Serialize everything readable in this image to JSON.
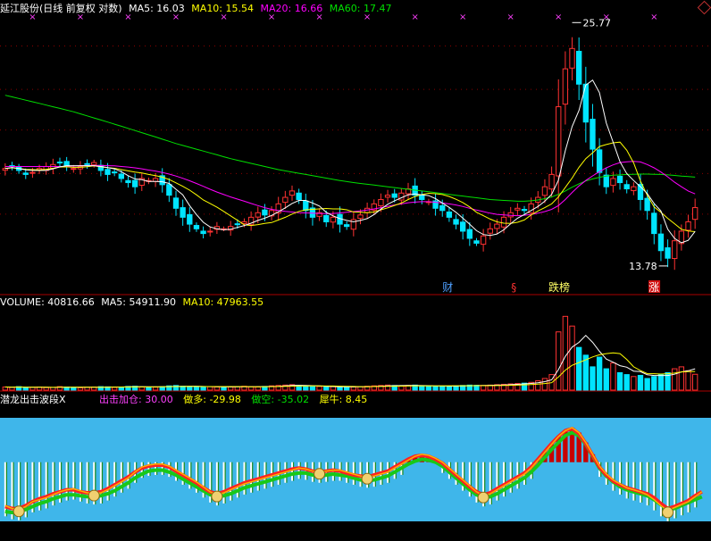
{
  "header": {
    "stock": "延江股份(日线 前复权 对数)",
    "ma5": "MA5: 16.03",
    "ma10": "MA10: 15.54",
    "ma20": "MA20: 16.66",
    "ma60": "MA60: 17.47"
  },
  "volume_header": {
    "label": "VOLUME: 40816.66",
    "ma5": "MA5: 54911.90",
    "ma10": "MA10: 47963.55"
  },
  "indicator_header": {
    "name": "潜龙出击波段X",
    "attack": "出击加仓: 30.00",
    "long": "做多: -29.98",
    "short": "做空: -35.02",
    "bull": "犀牛: 8.45"
  },
  "colors": {
    "up": "#ff3232",
    "down": "#00e4ff",
    "ma5": "#ffffff",
    "ma10": "#ffff00",
    "ma20": "#ff00ff",
    "ma60": "#00e000",
    "grid": "#8b0000",
    "indicator_bg": "#3fb6ea"
  },
  "chart_data": [
    {
      "type": "candlestick",
      "panel": "price",
      "scale": "log",
      "ylim": [
        12.8,
        27.5
      ],
      "max_label": "25.77",
      "min_label": "13.78",
      "events": [
        {
          "label": "财",
          "x": 0.64
        },
        {
          "label": "§",
          "x": 0.735
        },
        {
          "label": "跌榜",
          "x": 0.8
        },
        {
          "label": "涨",
          "x": 0.936
        }
      ],
      "closes": [
        17.9,
        18.0,
        17.8,
        17.6,
        17.7,
        17.9,
        18.0,
        18.1,
        18.2,
        18.0,
        17.9,
        18.0,
        18.1,
        18.2,
        17.8,
        17.6,
        17.7,
        17.4,
        17.2,
        17.0,
        17.4,
        17.3,
        17.4,
        17.1,
        16.6,
        16.0,
        15.6,
        15.3,
        15.1,
        14.9,
        15.0,
        15.2,
        15.1,
        15.2,
        15.3,
        15.4,
        15.6,
        15.8,
        15.7,
        15.9,
        16.2,
        16.5,
        16.8,
        16.4,
        15.9,
        15.6,
        15.8,
        15.4,
        15.6,
        15.3,
        15.2,
        15.5,
        15.7,
        16.0,
        16.2,
        16.4,
        16.6,
        16.5,
        16.7,
        16.9,
        16.6,
        16.4,
        16.3,
        16.0,
        15.9,
        15.6,
        15.3,
        15.0,
        14.7,
        14.5,
        14.8,
        15.1,
        15.3,
        15.6,
        15.8,
        16.0,
        15.9,
        16.2,
        16.5,
        17.0,
        17.6,
        21.3,
        23.7,
        25.1,
        22.7,
        20.4,
        18.9,
        17.7,
        17.0,
        17.4,
        17.2,
        16.9,
        17.0,
        16.4,
        15.9,
        14.9,
        14.2,
        13.9,
        14.6,
        15.0,
        15.4,
        16.03
      ],
      "ma5": [
        17.9,
        17.95,
        17.9,
        17.83,
        17.8,
        17.8,
        17.8,
        17.88,
        17.98,
        18.04,
        18.04,
        18.04,
        18.04,
        18.04,
        18.0,
        17.94,
        17.88,
        17.74,
        17.54,
        17.38,
        17.34,
        17.26,
        17.26,
        17.24,
        17.16,
        16.88,
        16.62,
        16.12,
        15.72,
        15.38,
        15.18,
        15.1,
        15.06,
        15.08,
        15.16,
        15.24,
        15.34,
        15.46,
        15.56,
        15.68,
        15.84,
        16.02,
        16.22,
        16.36,
        16.36,
        16.24,
        16.1,
        15.82,
        15.66,
        15.54,
        15.46,
        15.4,
        15.46,
        15.54,
        15.72,
        15.96,
        16.18,
        16.34,
        16.48,
        16.62,
        16.66,
        16.62,
        16.58,
        16.44,
        16.24,
        16.04,
        15.82,
        15.56,
        15.3,
        15.02,
        14.86,
        14.82,
        14.88,
        15.06,
        15.32,
        15.56,
        15.72,
        15.9,
        16.08,
        16.32,
        16.64,
        17.32,
        18.82,
        20.14,
        21.08,
        22.64,
        22.96,
        22.16,
        20.34,
        19.28,
        18.24,
        17.64,
        17.3,
        17.0,
        16.68,
        16.22,
        15.88,
        15.08,
        14.7,
        14.52,
        14.62,
        14.99
      ],
      "ma10": [
        17.9,
        17.93,
        17.9,
        17.85,
        17.84,
        17.83,
        17.86,
        17.91,
        17.97,
        17.98,
        17.96,
        17.96,
        17.99,
        18.03,
        17.98,
        17.94,
        17.91,
        17.84,
        17.78,
        17.72,
        17.67,
        17.6,
        17.54,
        17.47,
        17.35,
        17.19,
        17.02,
        16.84,
        16.62,
        16.38,
        16.22,
        16.05,
        15.86,
        15.66,
        15.47,
        15.27,
        15.24,
        15.28,
        15.33,
        15.37,
        15.48,
        15.6,
        15.74,
        15.86,
        15.93,
        15.95,
        15.97,
        15.99,
        15.97,
        15.97,
        15.93,
        15.83,
        15.82,
        15.8,
        15.83,
        15.93,
        16.02,
        16.13,
        16.24,
        16.4,
        16.54,
        16.63,
        16.69,
        16.67,
        16.63,
        16.54,
        16.41,
        16.26,
        16.06,
        15.82,
        15.67,
        15.52,
        15.4,
        15.34,
        15.33,
        15.38,
        15.48,
        15.7,
        15.88,
        16.03,
        16.2,
        16.52,
        16.97,
        17.42,
        17.96,
        18.4,
        18.71,
        19.04,
        19.15,
        19.24,
        19.28,
        18.84,
        18.18,
        17.28,
        16.6,
        16.06,
        15.82,
        15.55,
        15.32,
        15.08,
        15.01,
        14.98
      ],
      "ma20": [
        18.0,
        18.0,
        18.0,
        18.0,
        18.0,
        18.0,
        18.0,
        18.0,
        18.0,
        18.0,
        18.02,
        18.04,
        18.05,
        18.05,
        18.05,
        18.04,
        18.03,
        18.0,
        17.97,
        17.93,
        17.88,
        17.82,
        17.77,
        17.7,
        17.62,
        17.52,
        17.41,
        17.29,
        17.16,
        17.02,
        16.88,
        16.75,
        16.63,
        16.52,
        16.42,
        16.32,
        16.22,
        16.12,
        16.03,
        15.95,
        15.9,
        15.86,
        15.83,
        15.8,
        15.79,
        15.78,
        15.77,
        15.76,
        15.77,
        15.79,
        15.82,
        15.85,
        15.88,
        15.92,
        15.97,
        16.03,
        16.09,
        16.15,
        16.2,
        16.25,
        16.28,
        16.3,
        16.3,
        16.27,
        16.24,
        16.2,
        16.15,
        16.08,
        16.0,
        15.92,
        15.85,
        15.78,
        15.73,
        15.7,
        15.68,
        15.67,
        15.69,
        15.72,
        15.78,
        15.85,
        15.95,
        16.12,
        16.4,
        16.73,
        17.04,
        17.3,
        17.53,
        17.74,
        17.93,
        18.08,
        18.2,
        18.24,
        18.26,
        18.23,
        18.1,
        17.93,
        17.72,
        17.48,
        17.22,
        17.0,
        16.8,
        16.66
      ],
      "ma60": [
        22.0,
        21.9,
        21.8,
        21.7,
        21.6,
        21.5,
        21.4,
        21.3,
        21.2,
        21.1,
        21.0,
        20.88,
        20.76,
        20.64,
        20.52,
        20.4,
        20.28,
        20.16,
        20.04,
        19.92,
        19.8,
        19.68,
        19.56,
        19.44,
        19.32,
        19.2,
        19.1,
        19.0,
        18.9,
        18.8,
        18.7,
        18.6,
        18.5,
        18.4,
        18.32,
        18.24,
        18.16,
        18.08,
        18.0,
        17.92,
        17.84,
        17.78,
        17.72,
        17.66,
        17.6,
        17.54,
        17.48,
        17.42,
        17.36,
        17.3,
        17.25,
        17.2,
        17.16,
        17.12,
        17.08,
        17.04,
        17.0,
        16.96,
        16.92,
        16.88,
        16.84,
        16.8,
        16.76,
        16.72,
        16.68,
        16.64,
        16.6,
        16.56,
        16.52,
        16.48,
        16.44,
        16.4,
        16.38,
        16.36,
        16.34,
        16.32,
        16.32,
        16.34,
        16.38,
        16.44,
        16.52,
        16.64,
        16.8,
        16.98,
        17.14,
        17.28,
        17.38,
        17.46,
        17.52,
        17.56,
        17.58,
        17.6,
        17.61,
        17.62,
        17.62,
        17.61,
        17.6,
        17.58,
        17.55,
        17.52,
        17.5,
        17.47
      ]
    },
    {
      "type": "bar",
      "panel": "volume",
      "ylim": [
        0,
        200000
      ],
      "values": [
        8000,
        7000,
        9000,
        6000,
        7000,
        8000,
        6500,
        7000,
        9000,
        8000,
        7000,
        6000,
        7500,
        8000,
        9000,
        8500,
        7000,
        8000,
        9500,
        10000,
        8000,
        7000,
        7500,
        9000,
        11000,
        12000,
        10000,
        9000,
        8000,
        8500,
        9000,
        8000,
        7500,
        8000,
        9000,
        10000,
        9000,
        8000,
        9500,
        11000,
        12000,
        13000,
        14000,
        12000,
        10000,
        9000,
        9500,
        8500,
        9000,
        8000,
        7500,
        8000,
        9000,
        10000,
        11000,
        12000,
        13000,
        12000,
        11000,
        12000,
        13000,
        11000,
        10000,
        9000,
        9500,
        10000,
        11000,
        12000,
        13000,
        12500,
        12000,
        13000,
        14000,
        15000,
        16000,
        17000,
        18000,
        20000,
        24000,
        30000,
        40000,
        150000,
        190000,
        165000,
        110000,
        90000,
        60000,
        85000,
        55000,
        70000,
        45000,
        40000,
        35000,
        38000,
        30000,
        35000,
        40000,
        45000,
        55000,
        60000,
        50000,
        40817
      ],
      "ma5": [
        8000,
        7500,
        8000,
        7500,
        7400,
        7400,
        7300,
        6900,
        7500,
        7700,
        7700,
        7300,
        7500,
        7500,
        7500,
        7800,
        8000,
        8100,
        8400,
        9000,
        8900,
        8500,
        8400,
        8700,
        9300,
        9700,
        9900,
        10200,
        10000,
        9500,
        8900,
        8500,
        8200,
        8200,
        8300,
        8500,
        8700,
        8900,
        9200,
        9500,
        9900,
        10700,
        11900,
        12400,
        12200,
        11600,
        10900,
        9800,
        9200,
        8800,
        8500,
        8300,
        8400,
        8800,
        9500,
        10000,
        11000,
        11600,
        11800,
        12000,
        12200,
        11800,
        11400,
        11000,
        10900,
        10300,
        10300,
        10700,
        11300,
        11700,
        12100,
        12500,
        12900,
        13300,
        14000,
        15000,
        16000,
        17200,
        19000,
        21800,
        26400,
        52800,
        86800,
        110800,
        123000,
        141000,
        123000,
        100000,
        80000,
        72000,
        63000,
        59000,
        49000,
        47600,
        39600,
        37600,
        37600,
        37600,
        41000,
        47000,
        50000,
        54912
      ],
      "ma10": [
        8000,
        7500,
        8000,
        7500,
        7400,
        7400,
        7400,
        7200,
        7500,
        7500,
        7500,
        7400,
        7400,
        7300,
        7500,
        7700,
        7800,
        7800,
        8000,
        8300,
        8300,
        8300,
        8300,
        8600,
        8900,
        9200,
        9300,
        9400,
        9400,
        9300,
        9100,
        9100,
        9100,
        9100,
        9100,
        9100,
        8800,
        8700,
        8800,
        9000,
        9300,
        9600,
        10100,
        10500,
        10600,
        10700,
        10800,
        10600,
        10500,
        10100,
        9700,
        9400,
        9000,
        8900,
        9100,
        9500,
        9800,
        10000,
        10300,
        10500,
        10800,
        11000,
        11100,
        11100,
        11100,
        11200,
        11200,
        11200,
        11300,
        11400,
        11400,
        11600,
        11800,
        12100,
        12500,
        12900,
        13600,
        14400,
        15400,
        16900,
        19000,
        33800,
        51400,
        63900,
        71000,
        78000,
        85500,
        91000,
        94000,
        96000,
        94000,
        79000,
        60000,
        50400,
        42500,
        42200,
        41300,
        42400,
        44000,
        47000,
        47500,
        47964
      ]
    },
    {
      "type": "area",
      "panel": "indicator",
      "ylim": [
        -60,
        45
      ],
      "series": [
        {
          "name": "出击加仓",
          "values": [
            -44,
            -47,
            -48,
            -45,
            -40,
            -38,
            -36,
            -33,
            -30,
            -28,
            -27,
            -29,
            -31,
            -32,
            -31,
            -28,
            -24,
            -20,
            -16,
            -10,
            -5,
            -3,
            -2,
            -2,
            -4,
            -8,
            -12,
            -16,
            -20,
            -25,
            -30,
            -33,
            -31,
            -28,
            -25,
            -22,
            -20,
            -18,
            -16,
            -14,
            -12,
            -10,
            -8,
            -6,
            -7,
            -9,
            -10,
            -9,
            -8,
            -8,
            -10,
            -12,
            -14,
            -15,
            -14,
            -12,
            -10,
            -6,
            -2,
            2,
            6,
            8,
            7,
            4,
            0,
            -6,
            -12,
            -18,
            -24,
            -30,
            -34,
            -32,
            -28,
            -24,
            -20,
            -16,
            -12,
            -6,
            2,
            10,
            18,
            26,
            32,
            35,
            30,
            20,
            8,
            -4,
            -12,
            -18,
            -22,
            -26,
            -28,
            -30,
            -33,
            -38,
            -44,
            -49,
            -46,
            -43,
            -40,
            -35,
            -30
          ]
        },
        {
          "name": "做多",
          "values": [
            -45,
            -47,
            -47,
            -44,
            -40,
            -37,
            -35,
            -32,
            -30,
            -28,
            -28,
            -30,
            -31,
            -31,
            -30,
            -27,
            -23,
            -19,
            -15,
            -10,
            -6,
            -4,
            -3,
            -3,
            -5,
            -9,
            -13,
            -17,
            -21,
            -26,
            -30,
            -32,
            -30,
            -27,
            -24,
            -21,
            -19,
            -17,
            -15,
            -13,
            -11,
            -9,
            -7,
            -6,
            -7,
            -9,
            -10,
            -9,
            -8,
            -9,
            -11,
            -13,
            -14,
            -15,
            -13,
            -11,
            -9,
            -5,
            -1,
            3,
            6,
            7,
            6,
            3,
            -1,
            -7,
            -13,
            -19,
            -25,
            -30,
            -33,
            -31,
            -27,
            -23,
            -19,
            -15,
            -11,
            -5,
            3,
            11,
            19,
            26,
            32,
            34,
            29,
            19,
            7,
            -5,
            -13,
            -19,
            -23,
            -26,
            -28,
            -30,
            -32,
            -36,
            -42,
            -47,
            -45,
            -42,
            -39,
            -34,
            -29.98
          ]
        },
        {
          "name": "做空",
          "values": [
            -50,
            -51,
            -50,
            -48,
            -45,
            -42,
            -40,
            -37,
            -35,
            -33,
            -33,
            -34,
            -35,
            -35,
            -34,
            -32,
            -29,
            -25,
            -21,
            -16,
            -12,
            -9,
            -8,
            -8,
            -10,
            -13,
            -17,
            -21,
            -25,
            -29,
            -33,
            -35,
            -34,
            -32,
            -29,
            -26,
            -24,
            -22,
            -20,
            -18,
            -16,
            -14,
            -12,
            -11,
            -11,
            -13,
            -14,
            -13,
            -12,
            -13,
            -14,
            -16,
            -18,
            -19,
            -18,
            -16,
            -14,
            -10,
            -6,
            -2,
            1,
            3,
            2,
            0,
            -4,
            -10,
            -16,
            -22,
            -28,
            -33,
            -36,
            -35,
            -32,
            -28,
            -24,
            -20,
            -16,
            -10,
            -3,
            5,
            13,
            20,
            27,
            30,
            27,
            18,
            6,
            -6,
            -14,
            -20,
            -25,
            -28,
            -30,
            -32,
            -34,
            -38,
            -43,
            -48,
            -47,
            -44,
            -41,
            -38,
            -35.02
          ]
        }
      ]
    }
  ]
}
